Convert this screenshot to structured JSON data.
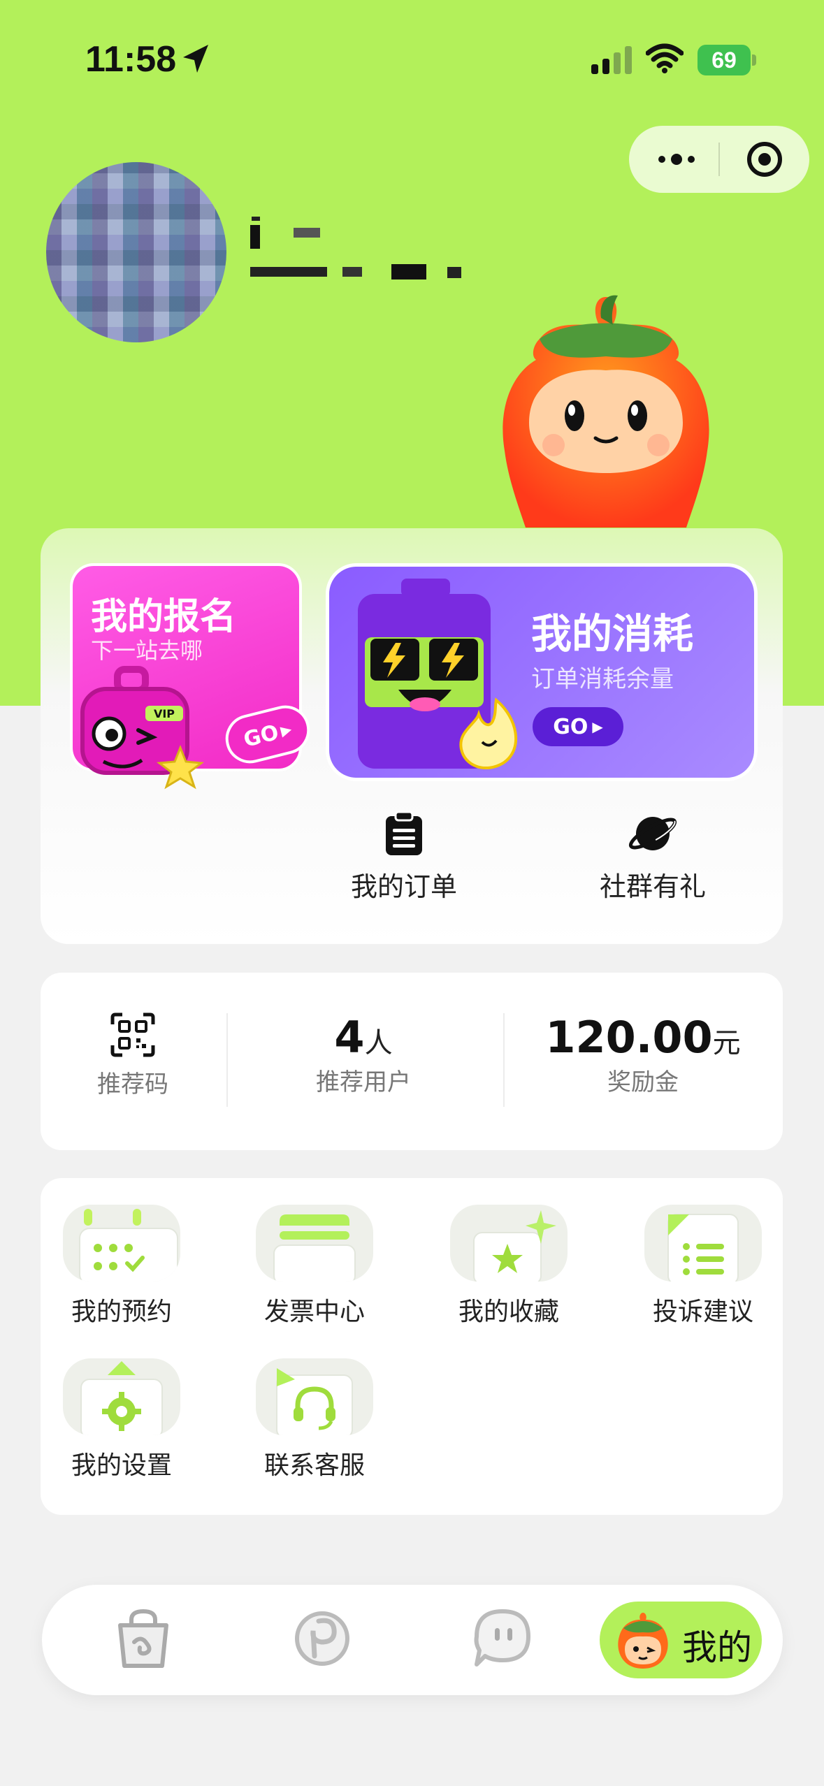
{
  "status_bar": {
    "time": "11:58",
    "battery": "69"
  },
  "signup_card": {
    "title": "我的报名",
    "subtitle": "下一站去哪",
    "go": "GO",
    "vip_badge": "VIP"
  },
  "consume_card": {
    "title": "我的消耗",
    "subtitle": "订单消耗余量",
    "go": "GO"
  },
  "quick_links": [
    {
      "label": "我的订单",
      "icon": "clipboard-icon"
    },
    {
      "label": "社群有礼",
      "icon": "planet-icon"
    }
  ],
  "stats": {
    "referral_code_label": "推荐码",
    "referred_users_value": "4",
    "referred_users_unit": "人",
    "referred_users_label": "推荐用户",
    "bonus_value": "120.00",
    "bonus_unit": "元",
    "bonus_label": "奖励金"
  },
  "services": [
    {
      "label": "我的预约",
      "icon": "calendar-icon"
    },
    {
      "label": "发票中心",
      "icon": "invoice-icon"
    },
    {
      "label": "我的收藏",
      "icon": "star-icon"
    },
    {
      "label": "投诉建议",
      "icon": "list-icon"
    },
    {
      "label": "我的设置",
      "icon": "gear-icon"
    },
    {
      "label": "联系客服",
      "icon": "headset-icon"
    }
  ],
  "tab_bar": {
    "active_label": "我的",
    "tabs": [
      "bag-icon",
      "discover-icon",
      "chat-icon",
      "mine-icon"
    ]
  },
  "colors": {
    "brand_green": "#b3f05a",
    "signup_pink": "#f22bc6",
    "consume_purple": "#8a5cff"
  }
}
